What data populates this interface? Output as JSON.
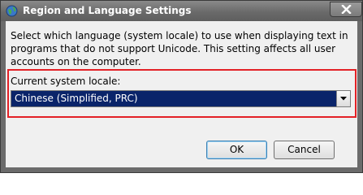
{
  "window": {
    "title": "Region and Language Settings",
    "icons": {
      "app": "app-globe-icon",
      "close": "close-icon"
    }
  },
  "dialog": {
    "description": "Select which language (system locale) to use when displaying text in programs that do not support Unicode. This setting affects all user accounts on the computer.",
    "locale_label": "Current system locale:",
    "locale_value": "Chinese (Simplified, PRC)",
    "dropdown_icon": "chevron-down-icon",
    "highlight_color": "#e32126",
    "selection_color": "#0a246a"
  },
  "buttons": {
    "ok": "OK",
    "cancel": "Cancel"
  }
}
